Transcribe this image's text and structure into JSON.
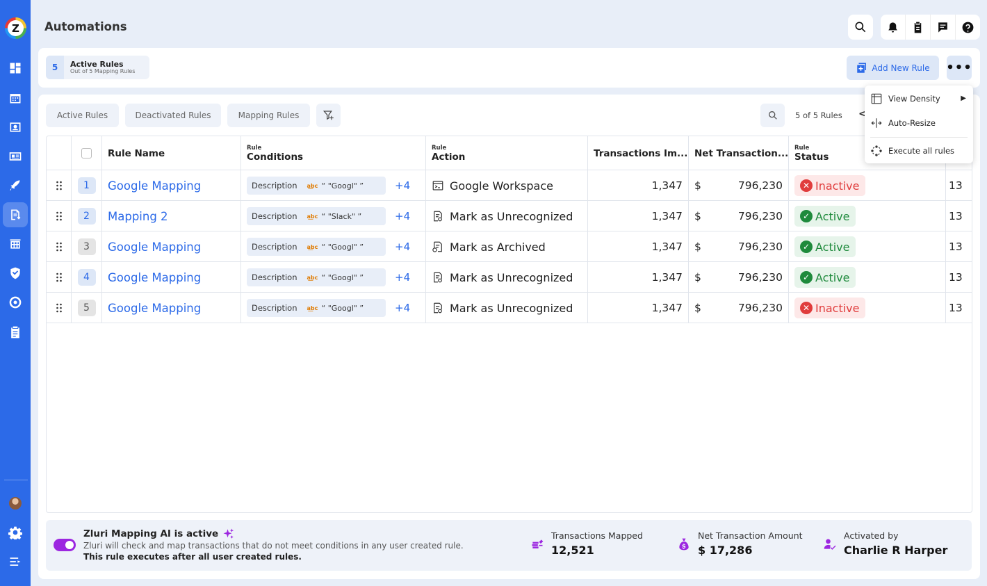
{
  "app": {
    "title": "Automations",
    "logo_letter": "Z"
  },
  "sidebar": {
    "items": [
      "dashboard-icon",
      "calendar-icon",
      "contact-card-icon",
      "id-card-icon",
      "rocket-icon",
      "mapping-icon",
      "building-icon",
      "shield-icon",
      "globe-icon",
      "clipboard-icon"
    ],
    "active": "mapping-icon",
    "bottom": [
      "avatar",
      "gear-icon",
      "menu-expand-icon"
    ]
  },
  "header": {
    "summary_count": "5",
    "summary_title": "Active Rules",
    "summary_sub": "Out of 5 Mapping Rules",
    "add_label": "Add New Rule",
    "more_label": "•••"
  },
  "tabs": [
    {
      "label": "Active Rules"
    },
    {
      "label": "Deactivated Rules"
    },
    {
      "label": "Mapping Rules"
    }
  ],
  "pagination": {
    "count": "5 of 5 Rules",
    "prev": "<"
  },
  "columns": {
    "rule_name": "Rule Name",
    "conditions_top": "Rule",
    "conditions": "Conditions",
    "action_top": "Rule",
    "action": "Action",
    "transactions": "Transactions Im...",
    "net": "Net Transaction...",
    "status_top": "Rule",
    "status": "Status"
  },
  "rows": [
    {
      "n": "1",
      "name": "Google Mapping",
      "cond_field": "Description",
      "cond_val": "“ \"Googl\" ”",
      "more": "+4",
      "action": "Google Workspace",
      "tx": "1,347",
      "cur": "$",
      "net": "796,230",
      "status": "Inactive",
      "trail": "13"
    },
    {
      "n": "2",
      "name": "Mapping 2",
      "cond_field": "Description",
      "cond_val": "“ \"Slack\" ”",
      "more": "+4",
      "action": "Mark as Unrecognized",
      "tx": "1,347",
      "cur": "$",
      "net": "796,230",
      "status": "Active",
      "trail": "13"
    },
    {
      "n": "3",
      "name": "Google Mapping",
      "cond_field": "Description",
      "cond_val": "“ \"Googl\" ”",
      "more": "+4",
      "action": "Mark as Archived",
      "tx": "1,347",
      "cur": "$",
      "net": "796,230",
      "status": "Active",
      "trail": "13"
    },
    {
      "n": "4",
      "name": "Google Mapping",
      "cond_field": "Description",
      "cond_val": "“ \"Googl\" ”",
      "more": "+4",
      "action": "Mark as Unrecognized",
      "tx": "1,347",
      "cur": "$",
      "net": "796,230",
      "status": "Active",
      "trail": "13"
    },
    {
      "n": "5",
      "name": "Google Mapping",
      "cond_field": "Description",
      "cond_val": "“ \"Googl\" ”",
      "more": "+4",
      "action": "Mark as Unrecognized",
      "tx": "1,347",
      "cur": "$",
      "net": "796,230",
      "status": "Inactive",
      "trail": "13"
    }
  ],
  "menu": {
    "view_density": "View Density",
    "auto_resize": "Auto-Resize",
    "execute_all": "Execute all rules"
  },
  "footer": {
    "ai_title": "Zluri Mapping AI is active",
    "ai_desc": "Zluri will check and map transactions that do not meet conditions in any user created rule.",
    "ai_note": "This rule executes after all user created rules.",
    "tx_label": "Transactions Mapped",
    "tx_value": "12,521",
    "net_label": "Net Transaction Amount",
    "net_value": "$ 17,286",
    "by_label": "Activated by",
    "by_value": "Charlie R Harper"
  },
  "colors": {
    "brand": "#2c6ae8",
    "inactive": "#e03c3c",
    "active": "#1e8a3c",
    "ai": "#9c27e0"
  }
}
